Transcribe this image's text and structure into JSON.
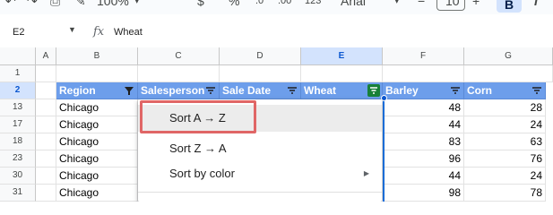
{
  "toolbar": {
    "zoom": "100%",
    "percent": "%",
    "decimals": "123",
    "font": "Arial",
    "font_size": "10",
    "plus": "+",
    "bold": "B"
  },
  "formula_bar": {
    "cell_ref": "E2",
    "fx": "fx",
    "value": "Wheat"
  },
  "columns": [
    "A",
    "B",
    "C",
    "D",
    "E",
    "F",
    "G"
  ],
  "rows": [
    "1",
    "2",
    "13",
    "17",
    "18",
    "23",
    "30",
    "31"
  ],
  "headers": {
    "region": "Region",
    "salesperson": "Salesperson",
    "sale_date": "Sale Date",
    "wheat": "Wheat",
    "barley": "Barley",
    "corn": "Corn"
  },
  "data_rows": [
    {
      "region": "Chicago",
      "barley": "48",
      "corn": "28"
    },
    {
      "region": "Chicago",
      "barley": "44",
      "corn": "24"
    },
    {
      "region": "Chicago",
      "barley": "83",
      "corn": "63"
    },
    {
      "region": "Chicago",
      "barley": "96",
      "corn": "76"
    },
    {
      "region": "Chicago",
      "barley": "44",
      "corn": "24"
    },
    {
      "region": "Chicago",
      "barley": "98",
      "corn": "78"
    }
  ],
  "menu": {
    "sort_az": "Sort A → Z",
    "sort_za": "Sort Z → A",
    "sort_color": "Sort by color"
  },
  "colors": {
    "header_fill": "#6d9eeb",
    "highlight_box": "#e06666",
    "active_filter": "#188038"
  }
}
